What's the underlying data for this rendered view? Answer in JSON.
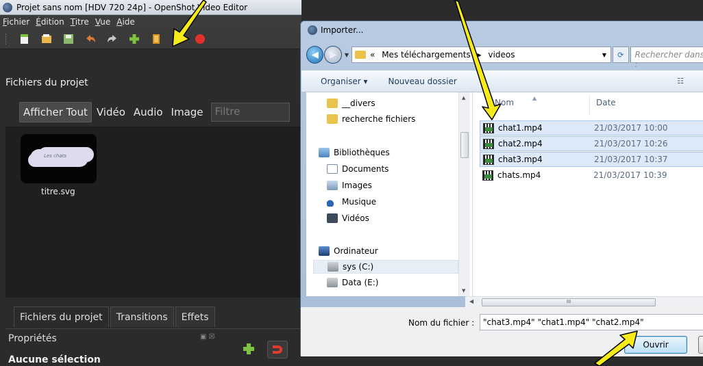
{
  "openshot": {
    "window_title": "Projet sans nom [HDV 720 24p] - OpenShot Video Editor",
    "menu": [
      "Fichier",
      "Édition",
      "Titre",
      "Vue",
      "Aide"
    ],
    "toolbar_icons": [
      "new-project-icon",
      "open-project-icon",
      "save-project-icon",
      "undo-icon",
      "redo-icon",
      "import-files-icon",
      "profile-icon",
      "fullscreen-icon",
      "record-icon"
    ],
    "panel_title": "Fichiers du projet",
    "filter_tabs": [
      "Afficher Tout",
      "Vidéo",
      "Audio",
      "Image"
    ],
    "filter_placeholder": "Filtre",
    "files": [
      {
        "thumb_text": "Les chats",
        "label": "titre.svg"
      }
    ],
    "bottom_tabs": [
      "Fichiers du projet",
      "Transitions",
      "Effets"
    ],
    "properties_title": "Propriétés",
    "properties_none": "Aucune sélection"
  },
  "dialog": {
    "title": "Importer...",
    "breadcrumb": [
      "«",
      "Mes téléchargements",
      "▸",
      "videos"
    ],
    "search_placeholder": "Rechercher dans :",
    "cmd_organize": "Organiser ▾",
    "cmd_new_folder": "Nouveau dossier",
    "nav": [
      {
        "label": "__divers",
        "icon": "folder"
      },
      {
        "label": "recherche fichiers",
        "icon": "folder"
      },
      {
        "label": "Bibliothèques",
        "icon": "lib"
      },
      {
        "label": "Documents",
        "icon": "doc"
      },
      {
        "label": "Images",
        "icon": "img"
      },
      {
        "label": "Musique",
        "icon": "music"
      },
      {
        "label": "Vidéos",
        "icon": "vid"
      },
      {
        "label": "Ordinateur",
        "icon": "pc"
      },
      {
        "label": "sys (C:)",
        "icon": "drive"
      },
      {
        "label": "Data (E:)",
        "icon": "drive"
      }
    ],
    "columns": [
      "Nom",
      "Date"
    ],
    "files": [
      {
        "name": "chat1.mp4",
        "date": "21/03/2017 10:00",
        "selected": true
      },
      {
        "name": "chat2.mp4",
        "date": "21/03/2017 10:26",
        "selected": true
      },
      {
        "name": "chat3.mp4",
        "date": "21/03/2017 10:37",
        "selected": true
      },
      {
        "name": "chats.mp4",
        "date": "21/03/2017 10:39",
        "selected": false
      }
    ],
    "filename_label": "Nom du fichier :",
    "filename_value": "\"chat3.mp4\" \"chat1.mp4\" \"chat2.mp4\"",
    "open_label": "Ouvrir"
  },
  "colors": {
    "annotation_arrow": "#f7ea1a",
    "accent_plus": "#7dc241",
    "record": "#e0322a"
  }
}
